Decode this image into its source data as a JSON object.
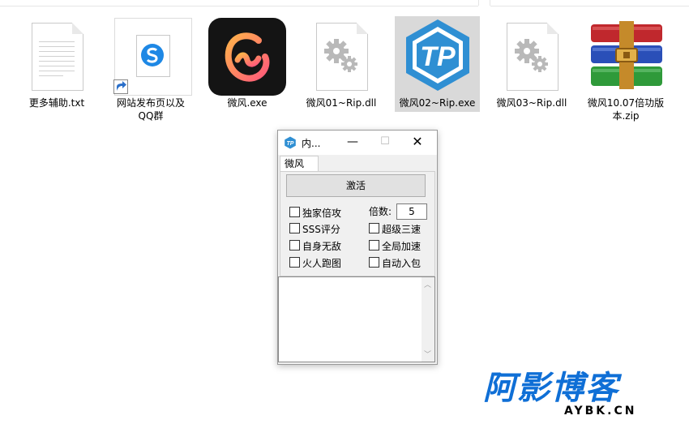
{
  "files": [
    {
      "name": "更多辅助.txt",
      "type": "text-file-icon"
    },
    {
      "name": "网站发布页以及QQ群",
      "type": "shortcut-icon"
    },
    {
      "name": "微风.exe",
      "type": "app-icon"
    },
    {
      "name": "微风01~Rip.dll",
      "type": "dll-gear-icon"
    },
    {
      "name": "微风02~Rip.exe",
      "type": "tp-app-icon",
      "selected": true
    },
    {
      "name": "微风03~Rip.dll",
      "type": "dll-gear-icon"
    },
    {
      "name": "微风10.07倍功版本.zip",
      "type": "zip-archive-icon"
    }
  ],
  "dialog": {
    "title": "内...",
    "tab": "微风",
    "activate_label": "激活",
    "multiplier_label": "倍数:",
    "multiplier_value": "5",
    "checkboxes": [
      {
        "label": "独家倍攻",
        "checked": false
      },
      {
        "label": "SSS评分",
        "checked": false
      },
      {
        "label": "自身无敌",
        "checked": false
      },
      {
        "label": "火人跑图",
        "checked": false
      },
      {
        "label": "超级三速",
        "checked": false
      },
      {
        "label": "全局加速",
        "checked": false
      },
      {
        "label": "自动入包",
        "checked": false
      }
    ]
  },
  "watermark": {
    "main": "阿影博客",
    "domain": "AYBK.CN"
  },
  "colors": {
    "selection": "#d9d9d9",
    "tp_blue": "#2f8fd3",
    "watermark_blue": "#0f6fd6"
  }
}
